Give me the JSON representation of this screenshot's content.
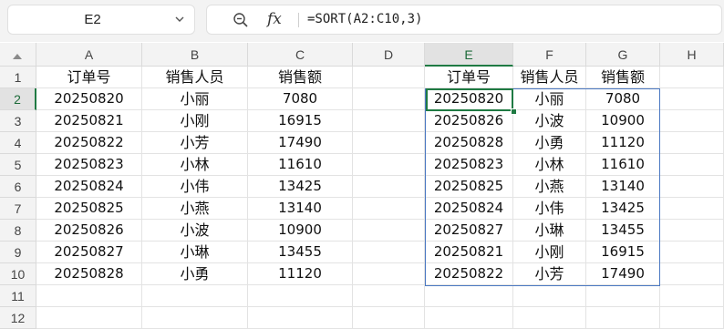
{
  "name_box": {
    "value": "E2"
  },
  "formula_bar": {
    "formula": "=SORT(A2:C10,3)",
    "fx_label": "fx"
  },
  "columns": [
    "A",
    "B",
    "C",
    "D",
    "E",
    "F",
    "G",
    "H"
  ],
  "selected_column": "E",
  "rows": [
    "1",
    "2",
    "3",
    "4",
    "5",
    "6",
    "7",
    "8",
    "9",
    "10",
    "11",
    "12"
  ],
  "selected_row": "2",
  "headers": {
    "order_no": "订单号",
    "salesperson": "销售人员",
    "amount": "销售额"
  },
  "source_data": [
    [
      "20250820",
      "小丽",
      "7080"
    ],
    [
      "20250821",
      "小刚",
      "16915"
    ],
    [
      "20250822",
      "小芳",
      "17490"
    ],
    [
      "20250823",
      "小林",
      "11610"
    ],
    [
      "20250824",
      "小伟",
      "13425"
    ],
    [
      "20250825",
      "小燕",
      "13140"
    ],
    [
      "20250826",
      "小波",
      "10900"
    ],
    [
      "20250827",
      "小琳",
      "13455"
    ],
    [
      "20250828",
      "小勇",
      "11120"
    ]
  ],
  "sorted_data": [
    [
      "20250820",
      "小丽",
      "7080"
    ],
    [
      "20250826",
      "小波",
      "10900"
    ],
    [
      "20250828",
      "小勇",
      "11120"
    ],
    [
      "20250823",
      "小林",
      "11610"
    ],
    [
      "20250825",
      "小燕",
      "13140"
    ],
    [
      "20250824",
      "小伟",
      "13425"
    ],
    [
      "20250827",
      "小琳",
      "13455"
    ],
    [
      "20250821",
      "小刚",
      "16915"
    ],
    [
      "20250822",
      "小芳",
      "17490"
    ]
  ],
  "colors": {
    "active_cell": "#1f7a43",
    "spill_range": "#4a78c2"
  }
}
